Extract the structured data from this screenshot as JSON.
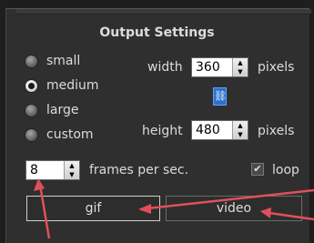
{
  "panel": {
    "title": "Output Settings"
  },
  "size_options": [
    {
      "label": "small",
      "selected": false
    },
    {
      "label": "medium",
      "selected": true
    },
    {
      "label": "large",
      "selected": false
    },
    {
      "label": "custom",
      "selected": false
    }
  ],
  "dimensions": {
    "width_label": "width",
    "width_value": "360",
    "height_label": "height",
    "height_value": "480",
    "units": "pixels",
    "link_icon": "link-icon"
  },
  "fps": {
    "value": "8",
    "label": "frames per sec."
  },
  "loop": {
    "label": "loop",
    "checked": true
  },
  "buttons": {
    "gif": "gif",
    "video": "video"
  },
  "colors": {
    "annotation_arrow": "#e0505a",
    "link_button": "#2a6fd1"
  }
}
